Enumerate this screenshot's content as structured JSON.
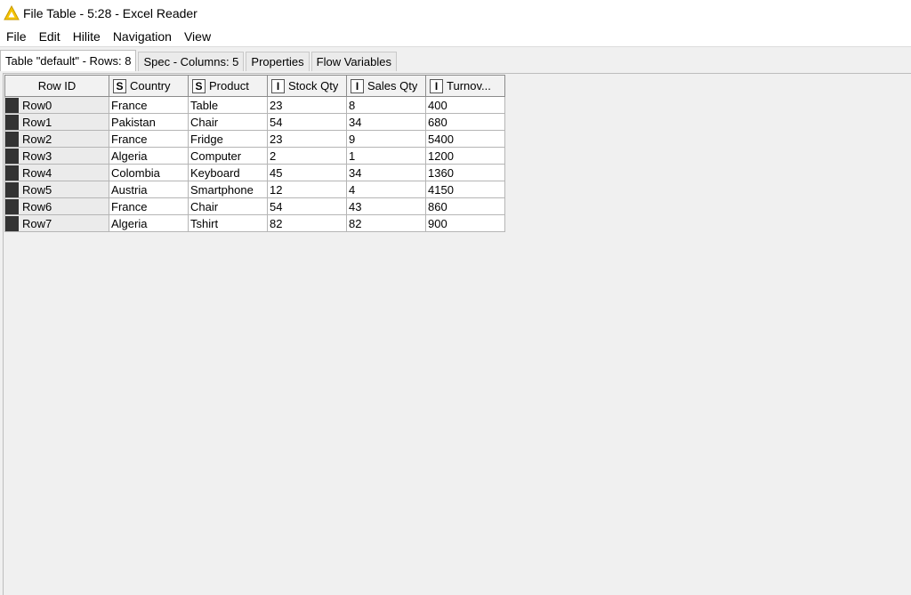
{
  "window": {
    "title": "File Table - 5:28 - Excel Reader"
  },
  "menu": [
    "File",
    "Edit",
    "Hilite",
    "Navigation",
    "View"
  ],
  "tabs": [
    {
      "label": "Table \"default\" - Rows: 8",
      "active": true
    },
    {
      "label": "Spec - Columns: 5",
      "active": false
    },
    {
      "label": "Properties",
      "active": false
    },
    {
      "label": "Flow Variables",
      "active": false
    }
  ],
  "table": {
    "row_id_header": "Row ID",
    "columns": [
      {
        "type": "S",
        "name": "Country"
      },
      {
        "type": "S",
        "name": "Product"
      },
      {
        "type": "I",
        "name": "Stock Qty"
      },
      {
        "type": "I",
        "name": "Sales Qty"
      },
      {
        "type": "I",
        "name": "Turnov..."
      }
    ],
    "rows": [
      {
        "id": "Row0",
        "cells": [
          "France",
          "Table",
          "23",
          "8",
          "400"
        ]
      },
      {
        "id": "Row1",
        "cells": [
          "Pakistan",
          "Chair",
          "54",
          "34",
          "680"
        ]
      },
      {
        "id": "Row2",
        "cells": [
          "France",
          "Fridge",
          "23",
          "9",
          "5400"
        ]
      },
      {
        "id": "Row3",
        "cells": [
          "Algeria",
          "Computer",
          "2",
          "1",
          "1200"
        ]
      },
      {
        "id": "Row4",
        "cells": [
          "Colombia",
          "Keyboard",
          "45",
          "34",
          "1360"
        ]
      },
      {
        "id": "Row5",
        "cells": [
          "Austria",
          "Smartphone",
          "12",
          "4",
          "4150"
        ]
      },
      {
        "id": "Row6",
        "cells": [
          "France",
          "Chair",
          "54",
          "43",
          "860"
        ]
      },
      {
        "id": "Row7",
        "cells": [
          "Algeria",
          "Tshirt",
          "82",
          "82",
          "900"
        ]
      }
    ]
  },
  "colors": {
    "icon_yellow": "#f5c400",
    "row_marker": "#333333"
  }
}
